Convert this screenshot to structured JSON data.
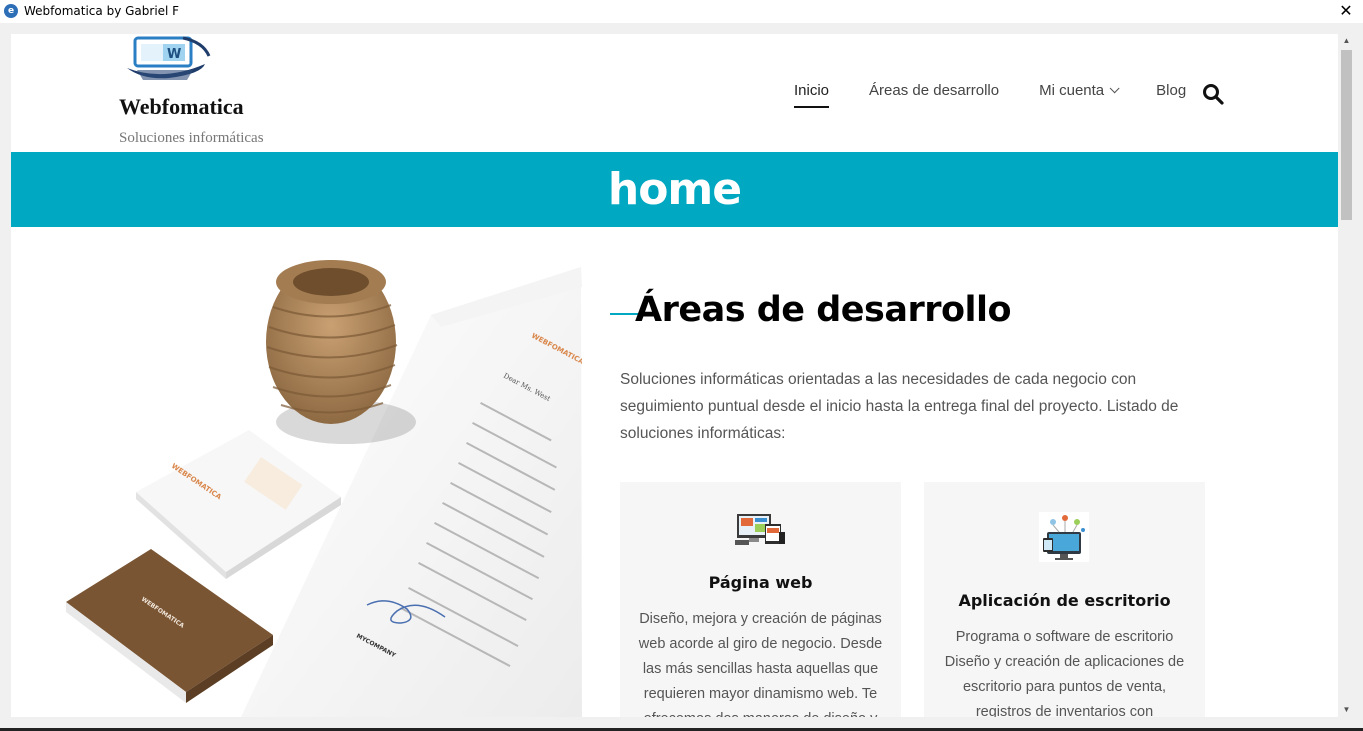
{
  "window": {
    "title": "Webfomatica by Gabriel F",
    "close_glyph": "✕",
    "icon": "app-globe-icon"
  },
  "header": {
    "site_name": "Webfomatica",
    "tagline": "Soluciones informáticas",
    "logo_letter": "W"
  },
  "nav": {
    "items": [
      {
        "label": "Inicio",
        "active": true
      },
      {
        "label": "Áreas de desarrollo",
        "active": false
      },
      {
        "label": "Mi cuenta",
        "active": false,
        "has_dropdown": true
      },
      {
        "label": "Blog",
        "active": false
      }
    ],
    "search_icon": "search-icon"
  },
  "banner": {
    "title": "home",
    "color": "#00a8c2"
  },
  "main": {
    "section_title": "Áreas de desarrollo",
    "section_text": "Soluciones informáticas orientadas a las necesidades de cada negocio con seguimiento puntual desde el inicio hasta la entrega final del proyecto. Listado de soluciones informáticas:",
    "cards": [
      {
        "title": "Página web",
        "icon": "web-devices-icon",
        "text": "Diseño, mejora y creación de páginas web acorde al giro de negocio. Desde las más sencillas hasta aquellas que requieren mayor dinamismo web. Te ofrecemos dos maneras de diseño y"
      },
      {
        "title": "Aplicación de escritorio",
        "icon": "desktop-app-icon",
        "text": "Programa o software de escritorio Diseño y creación de aplicaciones de escritorio para puntos de venta, registros de inventarios con interacción"
      }
    ]
  },
  "hero_image": {
    "brand_text": "WEBFOMATICA",
    "letter_greeting": "Dear Ms. West",
    "card_name": "MYCOMPANY"
  },
  "colors": {
    "accent": "#00a8c2",
    "card_background": "#f6f6f6",
    "stationery_brown": "#7a5533",
    "brand_orange": "#d9864a"
  }
}
